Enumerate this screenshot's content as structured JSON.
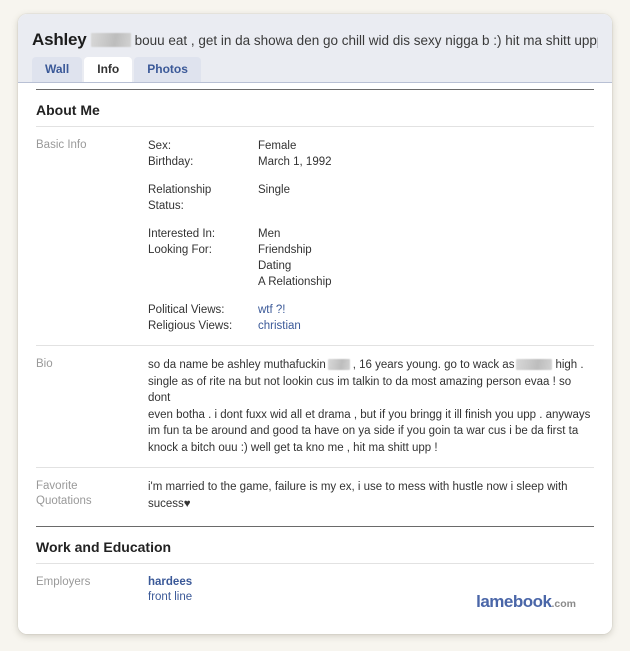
{
  "profile": {
    "name": "Ashley",
    "status_text": "bouu eat , get in da showa den go chill wid dis sexy nigga b :) hit ma shitt uppp !",
    "tabs": [
      {
        "label": "Wall",
        "active": false
      },
      {
        "label": "Info",
        "active": true
      },
      {
        "label": "Photos",
        "active": false
      }
    ]
  },
  "sections": {
    "about_me": {
      "title": "About Me",
      "basic_info": {
        "label": "Basic Info",
        "fields": [
          {
            "key": "Sex:",
            "value": "Female"
          },
          {
            "key": "Birthday:",
            "value": "March 1, 1992"
          },
          {
            "key": "Relationship Status:",
            "value": "Single"
          },
          {
            "key": "Interested In:",
            "value": "Men"
          },
          {
            "key": "Looking For:",
            "value": "Friendship"
          },
          {
            "key": "",
            "value": "Dating"
          },
          {
            "key": "",
            "value": "A Relationship"
          },
          {
            "key": "Political Views:",
            "value": "wtf ?!"
          },
          {
            "key": "Religious Views:",
            "value": "christian"
          }
        ]
      },
      "bio": {
        "label": "Bio",
        "line1_a": "so da name be ashley muthafuckin",
        "line1_b": ", 16 years young. go to wack as",
        "line1_c": "high .",
        "line2": "single as of rite na but not lookin cus im talkin to da most amazing person evaa ! so dont",
        "line3": "even botha . i dont fuxx wid all et drama , but if you bringg it ill finish you upp . anyways",
        "line4": "im fun ta be around and good ta have on ya side if you goin ta war cus i be da first ta",
        "line5": "knock a bitch ouu :) well get ta kno me , hit ma shitt upp !"
      },
      "favorite_quotations": {
        "label_line1": "Favorite",
        "label_line2": "Quotations",
        "line1": "i'm married to the game, failure is my ex, i use to mess with hustle now i sleep with",
        "line2": "sucess",
        "heart": "♥"
      }
    },
    "work_and_education": {
      "title": "Work and Education",
      "employers": {
        "label": "Employers",
        "company": "hardees",
        "position": "front line"
      }
    }
  },
  "watermark": {
    "brand": "lamebook",
    "tld": ".com"
  },
  "colors": {
    "link": "#3b5998",
    "header_bg": "#eaecf2",
    "tab_bg": "#dfe3ee",
    "page_bg": "#f7f5ef"
  }
}
